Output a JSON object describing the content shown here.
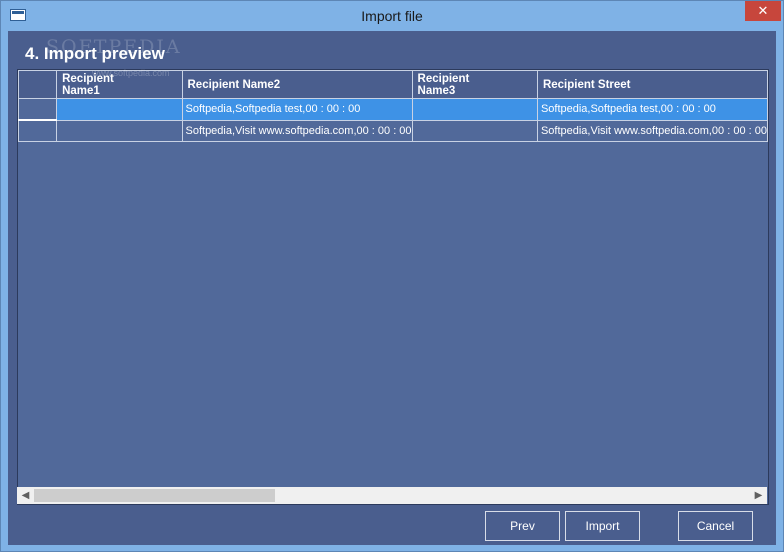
{
  "window": {
    "title": "Import file"
  },
  "header": {
    "step_title": "4. Import preview",
    "watermark": "SOFTPEDIA",
    "watermark_sub": "www.softpedia.com"
  },
  "grid": {
    "columns": [
      "Recipient\nName1",
      "Recipient Name2",
      "Recipient\nName3",
      "Recipient Street"
    ],
    "rows": [
      [
        "",
        "Softpedia,Softpedia test,00 : 00 : 00",
        "",
        "Softpedia,Softpedia test,00 : 00 : 00"
      ],
      [
        "",
        "Softpedia,Visit www.softpedia.com,00 : 00 : 00",
        "",
        "Softpedia,Visit www.softpedia.com,00 : 00 : 00"
      ]
    ]
  },
  "buttons": {
    "prev": "Prev",
    "import": "Import",
    "cancel": "Cancel"
  },
  "icons": {
    "close": "close-icon",
    "scroll_left": "chevron-left-icon",
    "scroll_right": "chevron-right-icon"
  },
  "colors": {
    "client_bg": "#4a5e8e",
    "grid_bg": "#51699a",
    "selection": "#3e92e6",
    "titlebar": "#7fb2e6",
    "close": "#c7463c"
  }
}
